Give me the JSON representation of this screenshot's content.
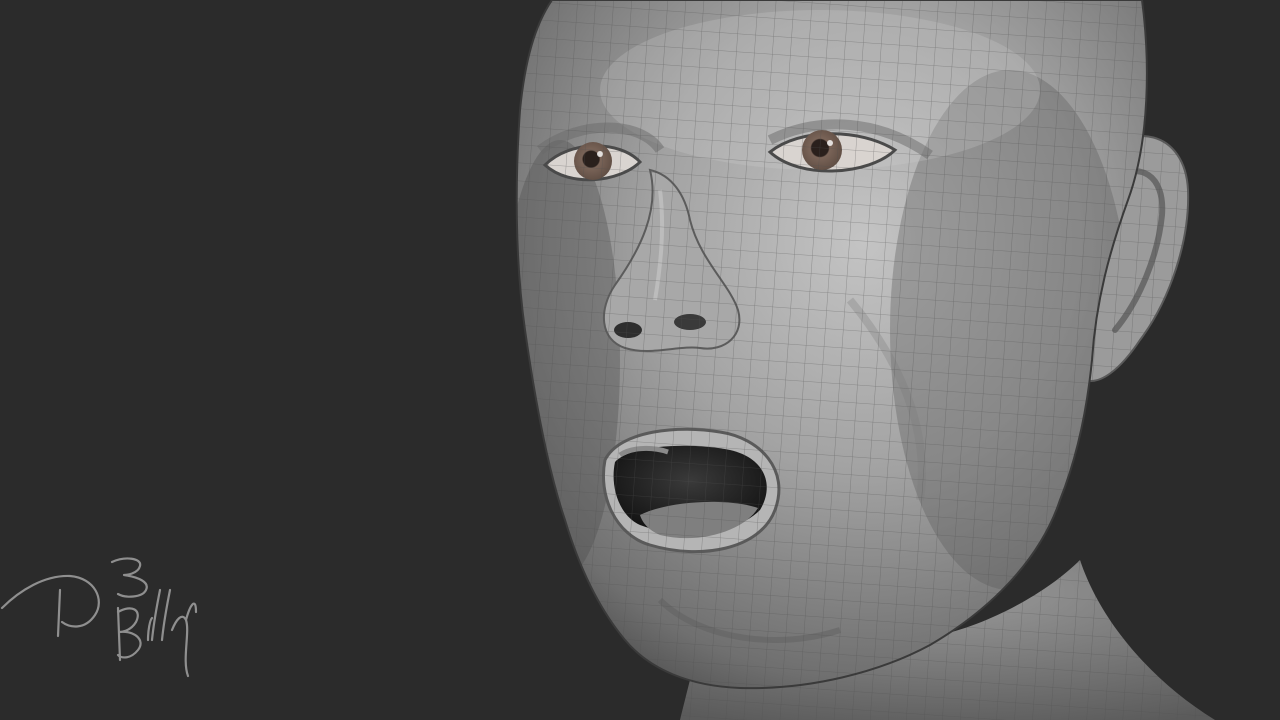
{
  "scene": {
    "background_color": "#2b2b2b",
    "subject": "sculpted-head-with-wireframe",
    "mesh_color": "#9a9a9a",
    "wire_color": "#4a4a4a",
    "iris_color": "#7a6458",
    "signature": {
      "color": "#8f8f8f",
      "is_handwritten": true,
      "text": "D3 Billy"
    }
  }
}
